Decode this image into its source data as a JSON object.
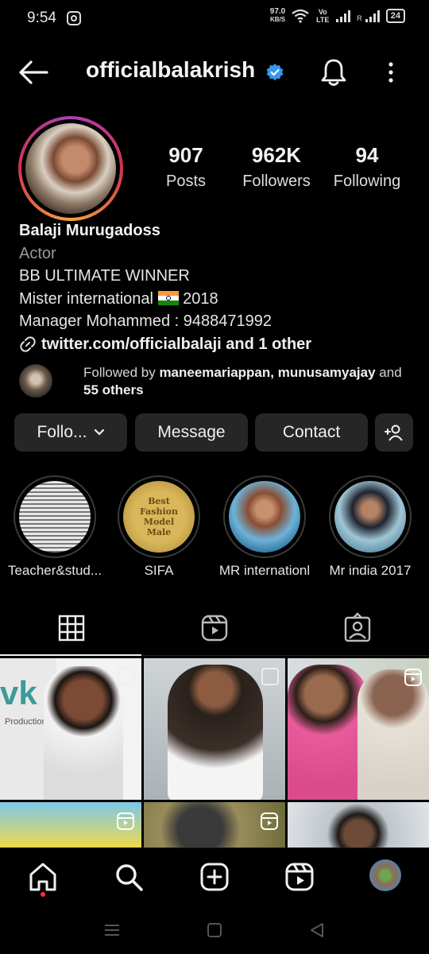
{
  "status_bar": {
    "time": "9:54",
    "net_speed": "97.0",
    "net_unit": "KB/S",
    "volte": "Vo LTE",
    "battery": "24",
    "icons": [
      "instagram-icon",
      "wifi-icon",
      "signal-icon",
      "battery-icon"
    ]
  },
  "header": {
    "username": "officialbalakrish",
    "verified": true,
    "icons": [
      "back-arrow-icon",
      "verified-badge-icon",
      "bell-icon",
      "more-vertical-icon"
    ]
  },
  "profile": {
    "stats": [
      {
        "value": "907",
        "label": "Posts"
      },
      {
        "value": "962K",
        "label": "Followers"
      },
      {
        "value": "94",
        "label": "Following"
      }
    ],
    "name": "Balaji Murugadoss",
    "category": "Actor",
    "bio_lines": [
      "BB ULTIMATE WINNER",
      "Mister international",
      "2018",
      "Manager Mohammed : 9488471992"
    ],
    "link": "twitter.com/officialbalaji and 1 other",
    "followed_by": {
      "prefix": "Followed by ",
      "names": "maneemariappan, munusamyajay",
      "and": " and",
      "others": "55 others"
    }
  },
  "actions": {
    "follow": "Follo...",
    "message": "Message",
    "contact": "Contact"
  },
  "highlights": [
    {
      "label": "Teacher&stud..."
    },
    {
      "label": "SIFA",
      "plaque_text": "Best Fashion Model Male"
    },
    {
      "label": "MR internationl"
    },
    {
      "label": "Mr india 2017"
    }
  ],
  "grid": {
    "post1_logo": "vk",
    "post1_text": "Productions"
  },
  "colors": {
    "background": "#000000",
    "button_bg": "#262626",
    "verified_blue": "#3897f0",
    "notification_dot": "#ff3040"
  }
}
